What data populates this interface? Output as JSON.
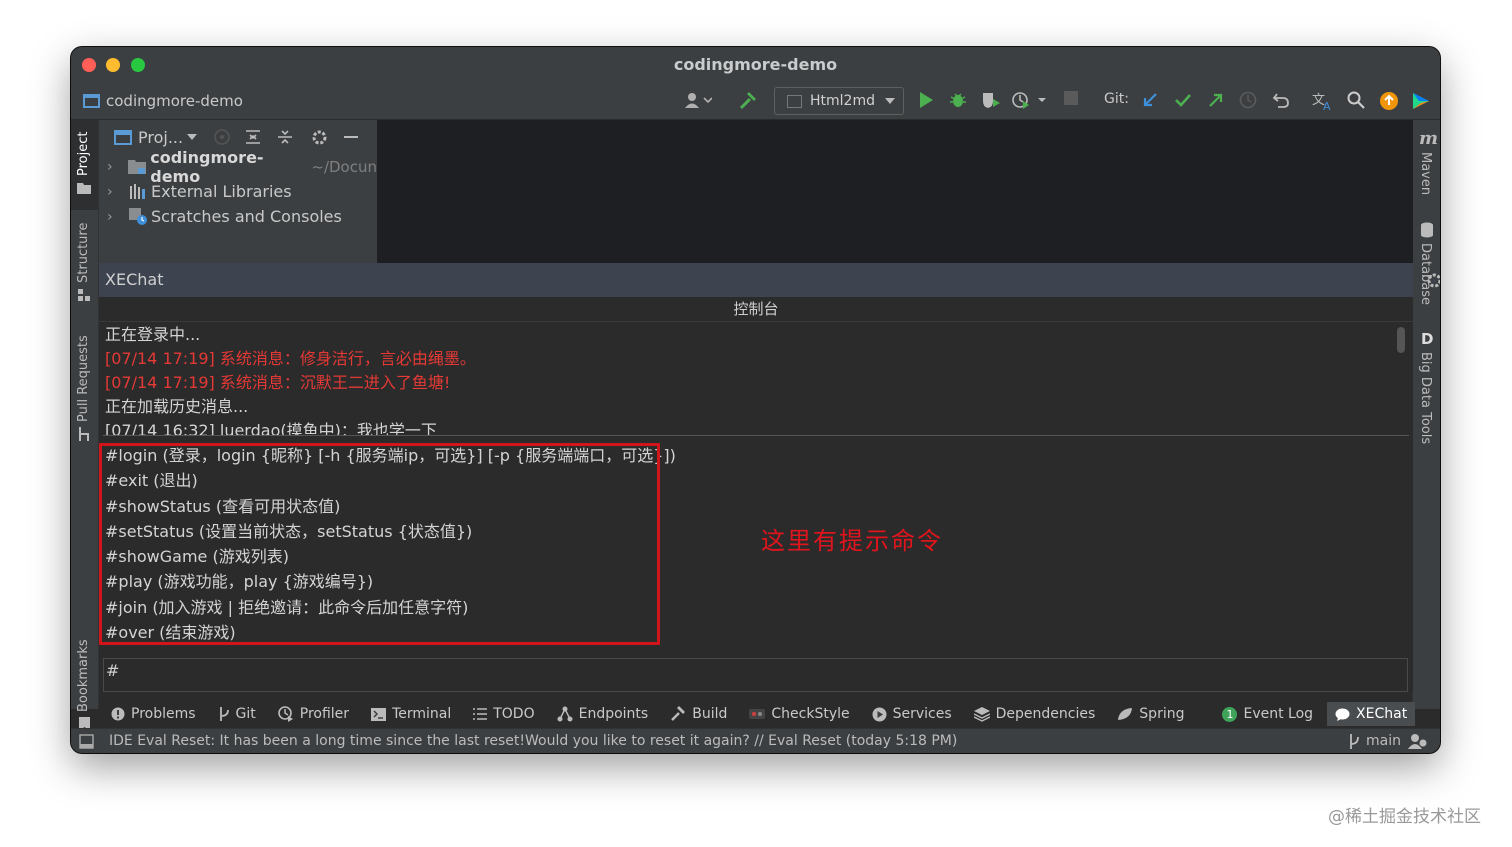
{
  "window": {
    "title": "codingmore-demo"
  },
  "navbar": {
    "project_name": "codingmore-demo",
    "run_config": "Html2md",
    "git_label": "Git:"
  },
  "left_tabs": [
    "Project",
    "Structure",
    "Pull Requests",
    "Bookmarks"
  ],
  "right_tabs": {
    "maven_label": "Maven",
    "maven_icon_letter": "m",
    "database_label": "Database",
    "bigdata_label": "Big Data Tools",
    "bigdata_icon_letter": "D"
  },
  "project_panel": {
    "header": "Proj...",
    "tree": [
      {
        "label": "codingmore-demo",
        "suffix": "~/Docun"
      },
      {
        "label": "External Libraries"
      },
      {
        "label": "Scratches and Consoles"
      }
    ]
  },
  "xechat": {
    "title": "XEChat",
    "console_title": "控制台",
    "log": [
      {
        "text": "正在登录中...",
        "color": "#d4d4d4"
      },
      {
        "text": "[07/14 17:19] 系统消息：修身洁行，言必由绳墨。",
        "color": "#e53935"
      },
      {
        "text": "[07/14 17:19] 系统消息：沉默王二进入了鱼塘!",
        "color": "#e53935"
      },
      {
        "text": "正在加载历史消息...",
        "color": "#d4d4d4"
      },
      {
        "text": "[07/14 16:32] luerdao(摸鱼中)：我也学一下",
        "color": "#d4d4d4"
      }
    ],
    "commands": [
      "#login (登录，login {昵称} [-h {服务端ip，可选}] [-p {服务端端口，可选}])",
      "#exit (退出)",
      "#showStatus (查看可用状态值)",
      "#setStatus (设置当前状态，setStatus {状态值})",
      "#showGame (游戏列表)",
      "#play (游戏功能，play {游戏编号})",
      "#join (加入游戏 | 拒绝邀请：此命令后加任意字符)",
      "#over (结束游戏)"
    ],
    "annotation": "这里有提示命令",
    "input_value": "#"
  },
  "bottom_tabs": [
    "Problems",
    "Git",
    "Profiler",
    "Terminal",
    "TODO",
    "Endpoints",
    "Build",
    "CheckStyle",
    "Services",
    "Dependencies",
    "Spring",
    "Event Log",
    "XEChat"
  ],
  "event_log_badge": "1",
  "status": {
    "message": "IDE Eval Reset: It has been a long time since the last reset!Would you like to reset it again? // Eval Reset (today 5:18 PM)",
    "branch": "main"
  },
  "watermark": "@稀土掘金技术社区",
  "colors": {
    "accent_red": "#e53935",
    "annotation_red": "#d0151c",
    "run_green": "#4caf50"
  }
}
